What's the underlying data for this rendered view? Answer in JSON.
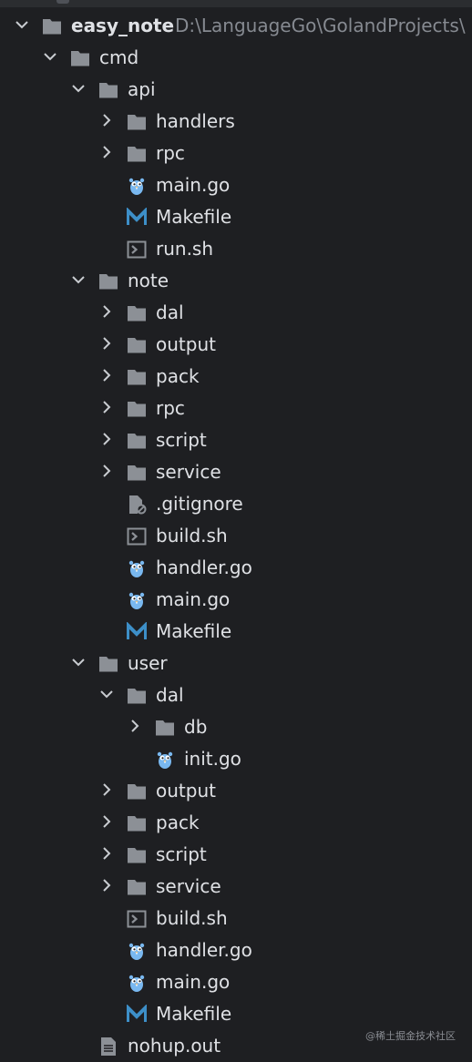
{
  "project": {
    "name": "easy_note",
    "path": "D:\\LanguageGo\\GolandProjects\\"
  },
  "rows": [
    {
      "id": "root",
      "depth": 0,
      "chevron": "down",
      "icon": "folder-icon",
      "label": "easy_note",
      "bold": true
    },
    {
      "id": "cmd",
      "depth": 1,
      "chevron": "down",
      "icon": "folder-icon",
      "label": "cmd"
    },
    {
      "id": "api",
      "depth": 2,
      "chevron": "down",
      "icon": "folder-icon",
      "label": "api"
    },
    {
      "id": "api-handlers",
      "depth": 3,
      "chevron": "right",
      "icon": "folder-icon",
      "label": "handlers"
    },
    {
      "id": "api-rpc",
      "depth": 3,
      "chevron": "right",
      "icon": "folder-icon",
      "label": "rpc"
    },
    {
      "id": "api-main",
      "depth": 3,
      "chevron": "none",
      "icon": "go-file-icon",
      "label": "main.go"
    },
    {
      "id": "api-makefile",
      "depth": 3,
      "chevron": "none",
      "icon": "makefile-icon",
      "label": "Makefile"
    },
    {
      "id": "api-run",
      "depth": 3,
      "chevron": "none",
      "icon": "shell-script-icon",
      "label": "run.sh"
    },
    {
      "id": "note",
      "depth": 2,
      "chevron": "down",
      "icon": "folder-icon",
      "label": "note"
    },
    {
      "id": "note-dal",
      "depth": 3,
      "chevron": "right",
      "icon": "folder-icon",
      "label": "dal"
    },
    {
      "id": "note-output",
      "depth": 3,
      "chevron": "right",
      "icon": "folder-icon",
      "label": "output"
    },
    {
      "id": "note-pack",
      "depth": 3,
      "chevron": "right",
      "icon": "folder-icon",
      "label": "pack"
    },
    {
      "id": "note-rpc",
      "depth": 3,
      "chevron": "right",
      "icon": "folder-icon",
      "label": "rpc"
    },
    {
      "id": "note-script",
      "depth": 3,
      "chevron": "right",
      "icon": "folder-icon",
      "label": "script"
    },
    {
      "id": "note-service",
      "depth": 3,
      "chevron": "right",
      "icon": "folder-icon",
      "label": "service"
    },
    {
      "id": "note-gitignore",
      "depth": 3,
      "chevron": "none",
      "icon": "gitignore-icon",
      "label": ".gitignore"
    },
    {
      "id": "note-build",
      "depth": 3,
      "chevron": "none",
      "icon": "shell-script-icon",
      "label": "build.sh"
    },
    {
      "id": "note-handler",
      "depth": 3,
      "chevron": "none",
      "icon": "go-file-icon",
      "label": "handler.go"
    },
    {
      "id": "note-main",
      "depth": 3,
      "chevron": "none",
      "icon": "go-file-icon",
      "label": "main.go"
    },
    {
      "id": "note-makefile",
      "depth": 3,
      "chevron": "none",
      "icon": "makefile-icon",
      "label": "Makefile"
    },
    {
      "id": "user",
      "depth": 2,
      "chevron": "down",
      "icon": "folder-icon",
      "label": "user"
    },
    {
      "id": "user-dal",
      "depth": 3,
      "chevron": "down",
      "icon": "folder-icon",
      "label": "dal"
    },
    {
      "id": "user-dal-db",
      "depth": 4,
      "chevron": "right",
      "icon": "folder-icon",
      "label": "db"
    },
    {
      "id": "user-dal-init",
      "depth": 4,
      "chevron": "none",
      "icon": "go-file-icon",
      "label": "init.go"
    },
    {
      "id": "user-output",
      "depth": 3,
      "chevron": "right",
      "icon": "folder-icon",
      "label": "output"
    },
    {
      "id": "user-pack",
      "depth": 3,
      "chevron": "right",
      "icon": "folder-icon",
      "label": "pack"
    },
    {
      "id": "user-script",
      "depth": 3,
      "chevron": "right",
      "icon": "folder-icon",
      "label": "script"
    },
    {
      "id": "user-service",
      "depth": 3,
      "chevron": "right",
      "icon": "folder-icon",
      "label": "service"
    },
    {
      "id": "user-build",
      "depth": 3,
      "chevron": "none",
      "icon": "shell-script-icon",
      "label": "build.sh"
    },
    {
      "id": "user-handler",
      "depth": 3,
      "chevron": "none",
      "icon": "go-file-icon",
      "label": "handler.go"
    },
    {
      "id": "user-main",
      "depth": 3,
      "chevron": "none",
      "icon": "go-file-icon",
      "label": "main.go"
    },
    {
      "id": "user-makefile",
      "depth": 3,
      "chevron": "none",
      "icon": "makefile-icon",
      "label": "Makefile"
    },
    {
      "id": "nohup",
      "depth": 2,
      "chevron": "none",
      "icon": "text-file-icon",
      "label": "nohup.out"
    }
  ],
  "watermark": "@稀土掘金技术社区",
  "colors": {
    "background": "#1e1f22",
    "text": "#dfe1e5",
    "path": "#868a91",
    "folder": "#8c9096",
    "go": "#79b8f0",
    "makefile": "#3d8fc8",
    "chevron": "#c9ccd1"
  }
}
